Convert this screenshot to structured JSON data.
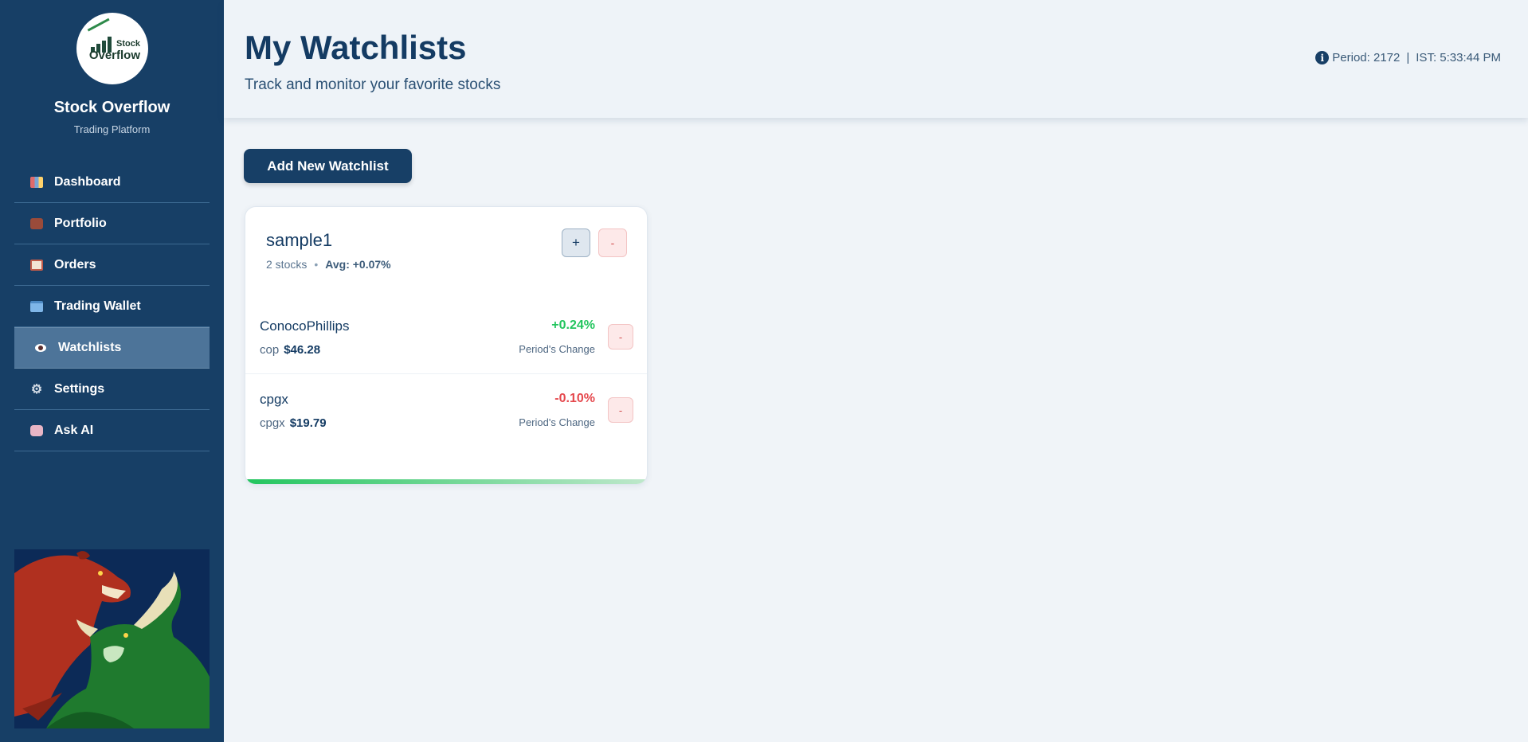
{
  "brand": {
    "logo_line1": "Stock",
    "logo_line2": "Overflow",
    "name": "Stock Overflow",
    "subtitle": "Trading Platform"
  },
  "sidebar": {
    "items": [
      {
        "label": "Dashboard",
        "icon": "chart-icon"
      },
      {
        "label": "Portfolio",
        "icon": "briefcase-icon"
      },
      {
        "label": "Orders",
        "icon": "clipboard-icon"
      },
      {
        "label": "Trading Wallet",
        "icon": "credit-card-icon"
      },
      {
        "label": "Watchlists",
        "icon": "eye-icon",
        "active": true
      },
      {
        "label": "Settings",
        "icon": "gear-icon"
      },
      {
        "label": "Ask AI",
        "icon": "robot-icon"
      }
    ]
  },
  "header": {
    "title": "My Watchlists",
    "subtitle": "Track and monitor your favorite stocks",
    "period": "Period: 2172",
    "separator": "|",
    "time": "IST: 5:33:44 PM",
    "info_glyph": "i"
  },
  "actions": {
    "add_watchlist": "Add New Watchlist"
  },
  "watchlist": {
    "name": "sample1",
    "count": "2 stocks",
    "dot": "•",
    "avg": "Avg: +0.07%",
    "add_glyph": "+",
    "remove_glyph": "-",
    "stocks": [
      {
        "name": "ConocoPhillips",
        "symbol": "cop",
        "price": "$46.28",
        "change": "+0.24%",
        "change_label": "Period's Change",
        "direction": "up"
      },
      {
        "name": "cpgx",
        "symbol": "cpgx",
        "price": "$19.79",
        "change": "-0.10%",
        "change_label": "Period's Change",
        "direction": "down"
      }
    ]
  },
  "colors": {
    "sidebar_bg": "#173f66",
    "positive": "#22c55e",
    "negative": "#e5484d",
    "primary": "#143b63"
  }
}
